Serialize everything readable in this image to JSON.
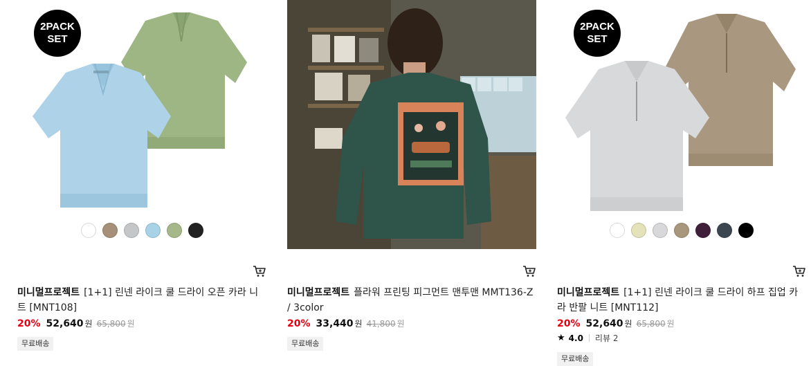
{
  "products": [
    {
      "badge_line1": "2PACK",
      "badge_line2": "SET",
      "brand": "미니멀프로젝트",
      "name": "[1+1] 린넨 라이크 쿨 드라이 오픈 카라 니트 [MNT108]",
      "discount": "20%",
      "price": "52,640",
      "price_unit": "원",
      "original_price": "65,800",
      "original_unit": "원",
      "shipping": "무료배송",
      "swatches": [
        "#ffffff",
        "#a69079",
        "#c4c6c8",
        "#a8d3e6",
        "#a6b88a",
        "#222222"
      ]
    },
    {
      "brand": "미니멀프로젝트",
      "name": "플라워 프린팅 피그먼트 맨투맨 MMT136-Z / 3color",
      "discount": "20%",
      "price": "33,440",
      "price_unit": "원",
      "original_price": "41,800",
      "original_unit": "원",
      "shipping": "무료배송",
      "print_text": "MINIMAL PROJECT"
    },
    {
      "badge_line1": "2PACK",
      "badge_line2": "SET",
      "brand": "미니멀프로젝트",
      "name": "[1+1] 린넨 라이크 쿨 드라이 하프 집업 카라 반팔 니트 [MNT112]",
      "discount": "20%",
      "price": "52,640",
      "price_unit": "원",
      "original_price": "65,800",
      "original_unit": "원",
      "rating_star": "★",
      "rating": "4.0",
      "reviews": "리뷰 2",
      "shipping": "무료배송",
      "swatches": [
        "#ffffff",
        "#e4e2b8",
        "#d8d8da",
        "#a8977c",
        "#3f1f3a",
        "#3c4650",
        "#000000"
      ]
    }
  ],
  "colors": {
    "discount": "#e60012",
    "tag_bg": "#f1f1f1"
  },
  "icons": {
    "cart": "cart-icon"
  }
}
